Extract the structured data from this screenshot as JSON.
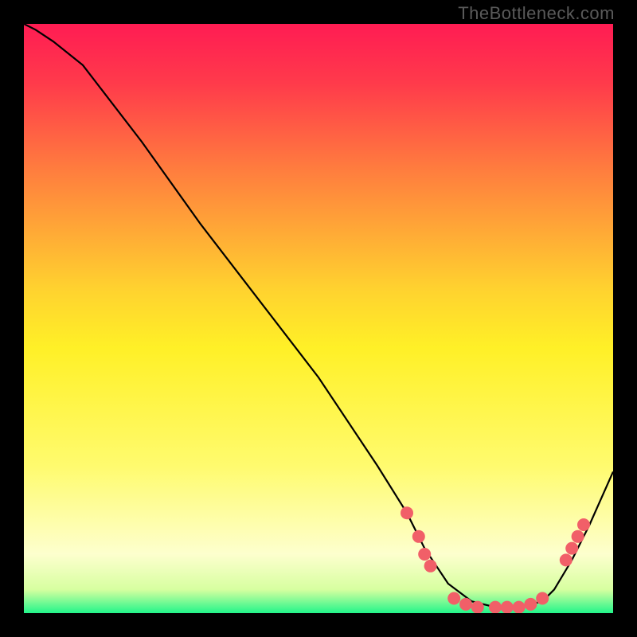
{
  "watermark": "TheBottleneck.com",
  "chart_data": {
    "type": "line",
    "title": "",
    "xlabel": "",
    "ylabel": "",
    "xlim": [
      0,
      100
    ],
    "ylim": [
      0,
      100
    ],
    "grid": false,
    "legend": false,
    "background_gradient_stops": [
      {
        "pct": 0,
        "color": "#ff1c53"
      },
      {
        "pct": 10,
        "color": "#ff3a4b"
      },
      {
        "pct": 25,
        "color": "#ff7e3e"
      },
      {
        "pct": 45,
        "color": "#ffd22f"
      },
      {
        "pct": 55,
        "color": "#fff027"
      },
      {
        "pct": 75,
        "color": "#fffb6e"
      },
      {
        "pct": 90,
        "color": "#fdffce"
      },
      {
        "pct": 96,
        "color": "#d7ffa0"
      },
      {
        "pct": 100,
        "color": "#22f58a"
      }
    ],
    "series": [
      {
        "name": "main-curve",
        "color": "#000000",
        "x": [
          0,
          2,
          5,
          10,
          20,
          30,
          40,
          50,
          60,
          65,
          68,
          72,
          76,
          80,
          84,
          88,
          90,
          93,
          96,
          100
        ],
        "y": [
          100,
          99,
          97,
          93,
          80,
          66,
          53,
          40,
          25,
          17,
          11,
          5,
          2,
          1,
          1,
          2,
          4,
          9,
          15,
          24
        ]
      }
    ],
    "highlight_points": {
      "name": "floor-dots",
      "color": "#f15f68",
      "radius": 8,
      "points": [
        {
          "x": 65,
          "y": 17
        },
        {
          "x": 67,
          "y": 13
        },
        {
          "x": 68,
          "y": 10
        },
        {
          "x": 69,
          "y": 8
        },
        {
          "x": 73,
          "y": 2.5
        },
        {
          "x": 75,
          "y": 1.5
        },
        {
          "x": 77,
          "y": 1
        },
        {
          "x": 80,
          "y": 1
        },
        {
          "x": 82,
          "y": 1
        },
        {
          "x": 84,
          "y": 1
        },
        {
          "x": 86,
          "y": 1.5
        },
        {
          "x": 88,
          "y": 2.5
        },
        {
          "x": 92,
          "y": 9
        },
        {
          "x": 93,
          "y": 11
        },
        {
          "x": 94,
          "y": 13
        },
        {
          "x": 95,
          "y": 15
        }
      ]
    }
  }
}
